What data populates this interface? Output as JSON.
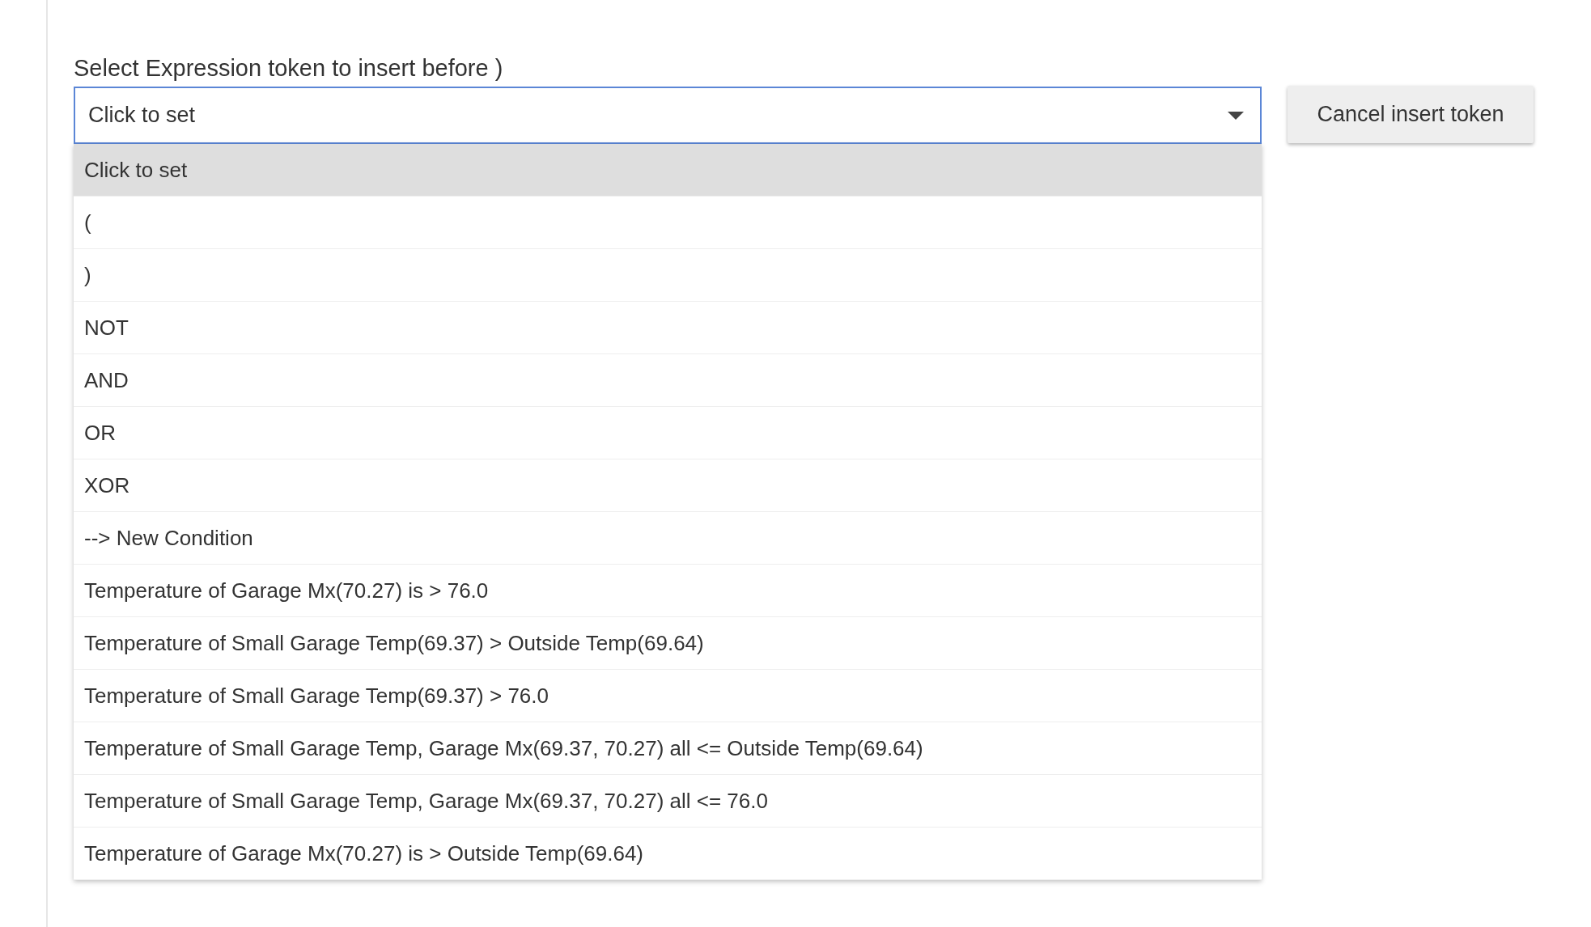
{
  "select": {
    "label": "Select Expression token to insert before )",
    "value": "Click to set",
    "options": [
      {
        "label": "Click to set",
        "selected": true
      },
      {
        "label": "(",
        "selected": false
      },
      {
        "label": ")",
        "selected": false
      },
      {
        "label": "NOT",
        "selected": false
      },
      {
        "label": "AND",
        "selected": false
      },
      {
        "label": "OR",
        "selected": false
      },
      {
        "label": "XOR",
        "selected": false
      },
      {
        "label": "--> New Condition",
        "selected": false
      },
      {
        "label": "Temperature of Garage Mx(70.27) is > 76.0",
        "selected": false
      },
      {
        "label": "Temperature of Small Garage Temp(69.37) > Outside Temp(69.64)",
        "selected": false
      },
      {
        "label": "Temperature of Small Garage Temp(69.37) > 76.0",
        "selected": false
      },
      {
        "label": "Temperature of Small Garage Temp, Garage Mx(69.37, 70.27) all <= Outside Temp(69.64)",
        "selected": false
      },
      {
        "label": "Temperature of Small Garage Temp, Garage Mx(69.37, 70.27) all <= 76.0",
        "selected": false
      },
      {
        "label": "Temperature of Garage Mx(70.27) is > Outside Temp(69.64)",
        "selected": false
      }
    ]
  },
  "cancel_button": "Cancel insert token"
}
